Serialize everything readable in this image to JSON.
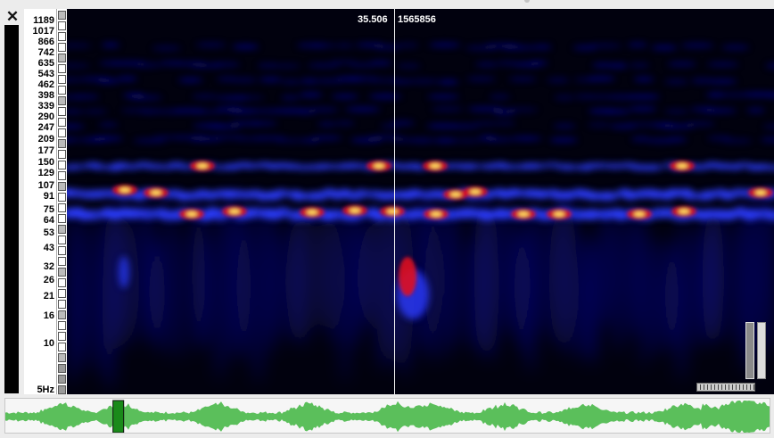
{
  "toolbar": {
    "close_glyph": "✕"
  },
  "frequency_axis": {
    "unit": "Hz",
    "ticks": [
      "1189",
      "1017",
      "866",
      "742",
      "635",
      "543",
      "462",
      "398",
      "339",
      "290",
      "247",
      "209",
      "177",
      "150",
      "129",
      "107",
      "91",
      "75",
      "64",
      "53",
      "43",
      "32",
      "26",
      "21",
      "16",
      "10",
      "5Hz"
    ]
  },
  "cursor": {
    "time": "35.506",
    "frequency": "1565856"
  },
  "overview": {
    "playhead_fraction": 0.144
  },
  "colors": {
    "background": "#01010e",
    "spectrum_low": "#1010a0",
    "spectrum_mid": "#2b3cff",
    "spectrum_high": "#e01020",
    "spectrum_peak": "#ffe060",
    "waveform": "#5bbf5b",
    "playhead": "#1a8a1a"
  }
}
